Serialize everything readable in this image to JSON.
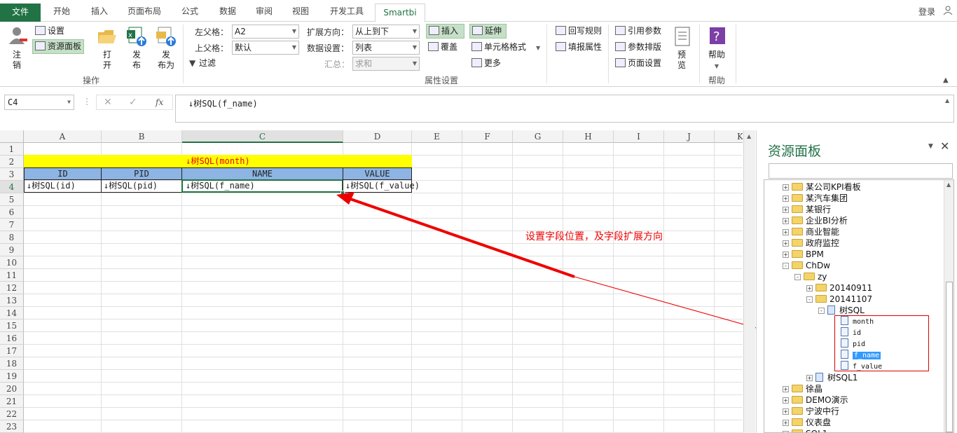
{
  "tabs": [
    {
      "label": "文件"
    },
    {
      "label": "开始"
    },
    {
      "label": "插入"
    },
    {
      "label": "页面布局"
    },
    {
      "label": "公式"
    },
    {
      "label": "数据"
    },
    {
      "label": "审阅"
    },
    {
      "label": "视图"
    },
    {
      "label": "开发工具"
    },
    {
      "label": "Smartbi"
    }
  ],
  "login_label": "登录",
  "ribbon": {
    "ops": {
      "logout_label1": "注",
      "logout_label2": "销",
      "settings_label": "设置",
      "resource_panel_label": "资源面板",
      "open_label1": "打",
      "open_label2": "开",
      "publish_label1": "发",
      "publish_label2": "布",
      "publish_as_label1": "发",
      "publish_as_label2": "布为",
      "group_label": "操作"
    },
    "props": {
      "left_parent_label": "左父格：",
      "left_parent_value": "A2",
      "top_parent_label": "上父格：",
      "top_parent_value": "默认",
      "filter_label": "过滤",
      "expand_dir_label": "扩展方向：",
      "expand_dir_value": "从上到下",
      "data_setting_label": "数据设置：",
      "data_setting_value": "列表",
      "summary_label": "汇总：",
      "summary_value": "求和",
      "insert_label": "插入",
      "overwrite_label": "覆盖",
      "extend_label": "延伸",
      "cell_format_label": "单元格格式",
      "more_label": "更多",
      "group_label": "属性设置"
    },
    "misc": {
      "writeback_label": "回写规则",
      "fill_attr_label": "填报属性",
      "ref_param_label": "引用参数",
      "param_layout_label": "参数排版",
      "page_setup_label": "页面设置",
      "preview_label1": "预",
      "preview_label2": "览",
      "help_label": "帮助",
      "help_group_label": "帮助"
    }
  },
  "formula_bar": {
    "name_box": "C4",
    "formula": "↓树SQL(f_name)",
    "fx_label": "fx"
  },
  "sheet": {
    "columns": [
      "A",
      "B",
      "C",
      "D",
      "E",
      "F",
      "G",
      "H",
      "I",
      "J",
      "K"
    ],
    "rows": [
      "1",
      "2",
      "3",
      "4",
      "5",
      "6",
      "7",
      "8",
      "9",
      "10",
      "11",
      "12",
      "13",
      "14",
      "15",
      "16",
      "17",
      "18",
      "19",
      "20",
      "21",
      "22",
      "23"
    ],
    "title_cell": "↓树SQL(month)",
    "headers": [
      "ID",
      "PID",
      "NAME",
      "VALUE"
    ],
    "data_row": [
      "↓树SQL(id)",
      "↓树SQL(pid)",
      "↓树SQL(f_name)",
      "↓树SQL(f_value)"
    ],
    "highlight_color": "#ffff00",
    "header_color": "#8db4e2"
  },
  "annotation": {
    "text": "设置字段位置，及字段扩展方向",
    "color": "#e00000"
  },
  "panel": {
    "title": "资源面板",
    "tree": [
      {
        "label": "某公司KPI看板",
        "expand": "+"
      },
      {
        "label": "某汽车集团",
        "expand": "+"
      },
      {
        "label": "某银行",
        "expand": "+"
      },
      {
        "label": "企业BI分析",
        "expand": "+"
      },
      {
        "label": "商业智能",
        "expand": "+"
      },
      {
        "label": "政府监控",
        "expand": "+"
      },
      {
        "label": "BPM",
        "expand": "+"
      },
      {
        "label": "ChDw",
        "expand": "-"
      },
      {
        "label": "zy",
        "expand": "-"
      },
      {
        "label": "20140911",
        "expand": "+"
      },
      {
        "label": "20141107",
        "expand": "-"
      },
      {
        "label": "树SQL",
        "expand": "-"
      },
      {
        "label": "month"
      },
      {
        "label": "id"
      },
      {
        "label": "pid"
      },
      {
        "label": "f_name"
      },
      {
        "label": "f_value"
      },
      {
        "label": "树SQL1",
        "expand": "+"
      },
      {
        "label": "徐晶",
        "expand": "+"
      },
      {
        "label": "DEMO演示",
        "expand": "+"
      },
      {
        "label": "宁波中行",
        "expand": "+"
      },
      {
        "label": "仪表盘",
        "expand": "+"
      },
      {
        "label": "SQL1",
        "expand": "+"
      }
    ]
  }
}
